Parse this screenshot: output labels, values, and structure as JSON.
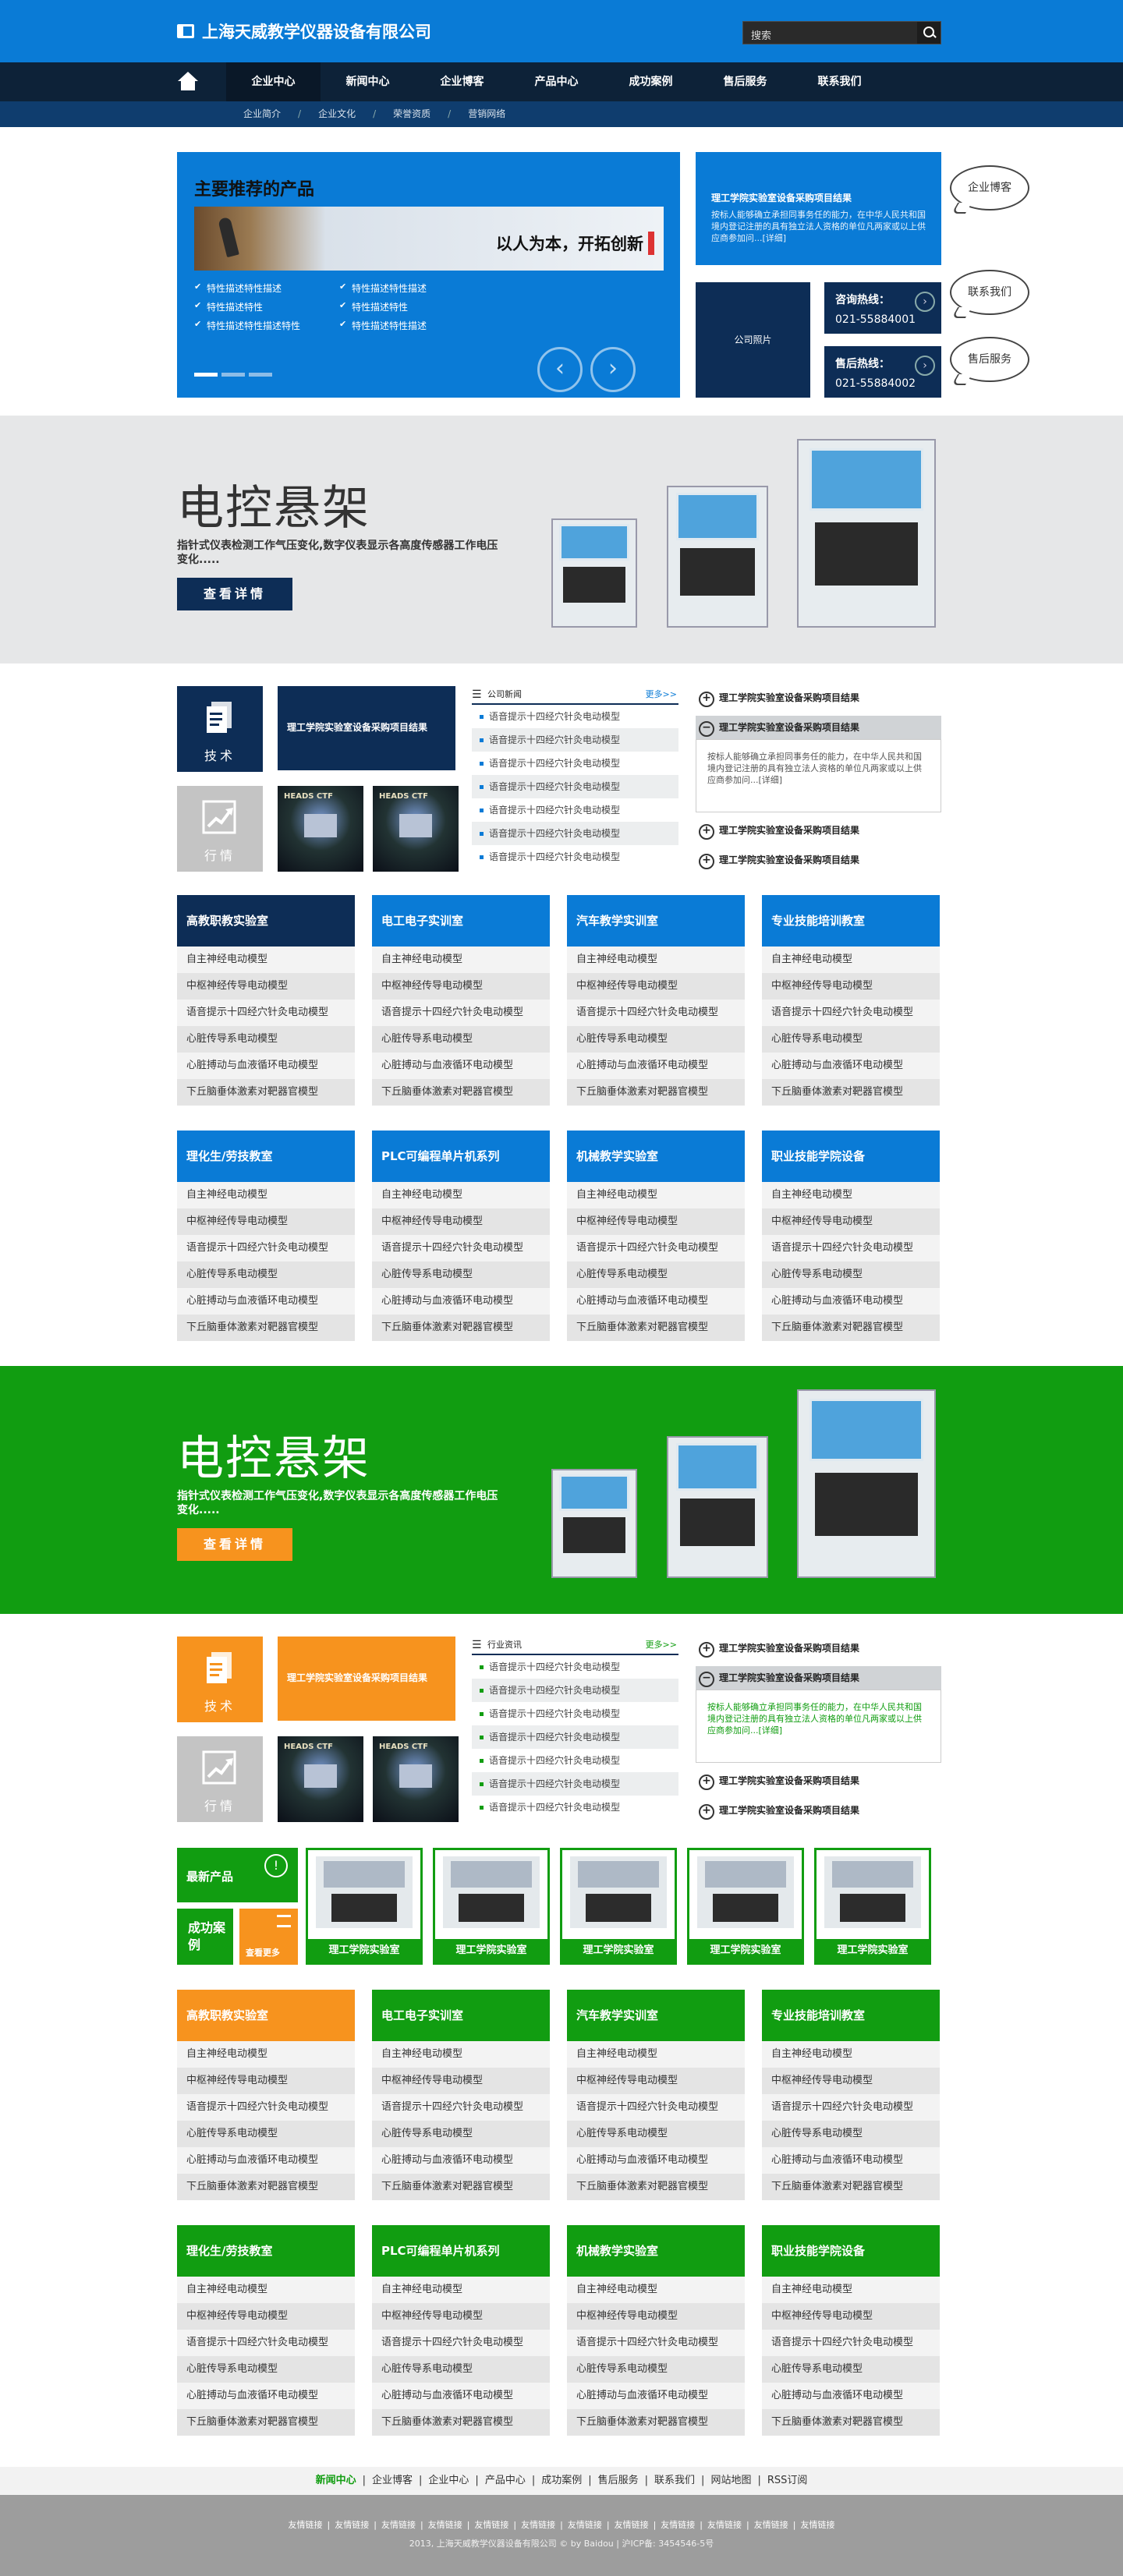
{
  "header": {
    "logo_text": "上海天威教学仪器设备有限公司",
    "search_placeholder": "搜索",
    "nav": [
      "企业中心",
      "新闻中心",
      "企业博客",
      "产品中心",
      "成功案例",
      "售后服务",
      "联系我们"
    ],
    "nav_active": 0,
    "subnav": [
      "企业简介",
      "企业文化",
      "荣誉资质",
      "营销网络"
    ]
  },
  "hero": {
    "title": "主要推荐的产品",
    "slogan": "以人为本，开拓创新",
    "features": [
      "特性描述特性描述",
      "特性描述特性",
      "特性描述特性描述特性",
      "特性描述特性描述",
      "特性描述特性",
      "特性描述特性描述"
    ],
    "news_title": "理工学院实验室设备采购项目结果",
    "news_text": "按标人能够确立承担同事务任的能力，在中华人民共和国境内登记注册的具有独立法人资格的单位凡两家或以上供应商参加问...[详细]",
    "photo_label": "公司照片",
    "hotline1_label": "咨询热线：",
    "hotline1": "021-55884001",
    "hotline2_label": "售后热线：",
    "hotline2": "021-55884002",
    "bubbles": [
      "企业博客",
      "联系我们",
      "售后服务"
    ]
  },
  "banner1": {
    "title": "电控悬架",
    "text": "指针式仪表检测工作气压变化,数字仪表显示各高度传感器工作电压变化.....",
    "button": "查看详情"
  },
  "block1": {
    "tile1": "技术",
    "tile2": "行情",
    "feature": "理工学院实验室设备采购项目结果",
    "thumb_text": "HEADS CTF",
    "list_title": "公司新闻",
    "more": "更多>>",
    "list": [
      "语音提示十四经穴针灸电动模型",
      "语音提示十四经穴针灸电动模型",
      "语音提示十四经穴针灸电动模型",
      "语音提示十四经穴针灸电动模型",
      "语音提示十四经穴针灸电动模型",
      "语音提示十四经穴针灸电动模型",
      "语音提示十四经穴针灸电动模型"
    ],
    "acc": [
      "理工学院实验室设备采购项目结果",
      "理工学院实验室设备采购项目结果",
      "理工学院实验室设备采购项目结果",
      "理工学院实验室设备采购项目结果"
    ],
    "acc_body": "按标人能够确立承担同事务任的能力，在中华人民共和国境内登记注册的具有独立法人资格的单位凡两家或以上供应商参加问...[详细]"
  },
  "grid1": [
    {
      "title": "高教职教实验室",
      "items": [
        "自主神经电动模型",
        "中枢神经传导电动模型",
        "语音提示十四经穴针灸电动模型",
        "心脏传导系电动模型",
        "心脏搏动与血液循环电动模型",
        "下丘脑垂体激素对靶器官模型"
      ]
    },
    {
      "title": "电工电子实训室",
      "items": [
        "自主神经电动模型",
        "中枢神经传导电动模型",
        "语音提示十四经穴针灸电动模型",
        "心脏传导系电动模型",
        "心脏搏动与血液循环电动模型",
        "下丘脑垂体激素对靶器官模型"
      ]
    },
    {
      "title": "汽车教学实训室",
      "items": [
        "自主神经电动模型",
        "中枢神经传导电动模型",
        "语音提示十四经穴针灸电动模型",
        "心脏传导系电动模型",
        "心脏搏动与血液循环电动模型",
        "下丘脑垂体激素对靶器官模型"
      ]
    },
    {
      "title": "专业技能培训教室",
      "items": [
        "自主神经电动模型",
        "中枢神经传导电动模型",
        "语音提示十四经穴针灸电动模型",
        "心脏传导系电动模型",
        "心脏搏动与血液循环电动模型",
        "下丘脑垂体激素对靶器官模型"
      ]
    },
    {
      "title": "理化生/劳技教室",
      "items": [
        "自主神经电动模型",
        "中枢神经传导电动模型",
        "语音提示十四经穴针灸电动模型",
        "心脏传导系电动模型",
        "心脏搏动与血液循环电动模型",
        "下丘脑垂体激素对靶器官模型"
      ]
    },
    {
      "title": "PLC可编程单片机系列",
      "items": [
        "自主神经电动模型",
        "中枢神经传导电动模型",
        "语音提示十四经穴针灸电动模型",
        "心脏传导系电动模型",
        "心脏搏动与血液循环电动模型",
        "下丘脑垂体激素对靶器官模型"
      ]
    },
    {
      "title": "机械教学实验室",
      "items": [
        "自主神经电动模型",
        "中枢神经传导电动模型",
        "语音提示十四经穴针灸电动模型",
        "心脏传导系电动模型",
        "心脏搏动与血液循环电动模型",
        "下丘脑垂体激素对靶器官模型"
      ]
    },
    {
      "title": "职业技能学院设备",
      "items": [
        "自主神经电动模型",
        "中枢神经传导电动模型",
        "语音提示十四经穴针灸电动模型",
        "心脏传导系电动模型",
        "心脏搏动与血液循环电动模型",
        "下丘脑垂体激素对靶器官模型"
      ]
    }
  ],
  "banner2": {
    "title": "电控悬架",
    "text": "指针式仪表检测工作气压变化,数字仪表显示各高度传感器工作电压变化.....",
    "button": "查看详情"
  },
  "block2": {
    "tile1": "技术",
    "tile2": "行情",
    "feature": "理工学院实验室设备采购项目结果",
    "thumb_text": "HEADS CTF",
    "list_title": "行业资讯",
    "more": "更多>>",
    "list": [
      "语音提示十四经穴针灸电动模型",
      "语音提示十四经穴针灸电动模型",
      "语音提示十四经穴针灸电动模型",
      "语音提示十四经穴针灸电动模型",
      "语音提示十四经穴针灸电动模型",
      "语音提示十四经穴针灸电动模型",
      "语音提示十四经穴针灸电动模型"
    ],
    "acc": [
      "理工学院实验室设备采购项目结果",
      "理工学院实验室设备采购项目结果",
      "理工学院实验室设备采购项目结果",
      "理工学院实验室设备采购项目结果"
    ],
    "acc_body": "按标人能够确立承担同事务任的能力，在中华人民共和国境内登记注册的具有独立法人资格的单位凡两家或以上供应商参加问...[详细]"
  },
  "products": {
    "latest": "最新产品",
    "cases": "成功案例",
    "more": "查看更多",
    "items": [
      "理工学院实验室",
      "理工学院实验室",
      "理工学院实验室",
      "理工学院实验室",
      "理工学院实验室"
    ]
  },
  "grid2": [
    {
      "title": "高教职教实验室",
      "items": [
        "自主神经电动模型",
        "中枢神经传导电动模型",
        "语音提示十四经穴针灸电动模型",
        "心脏传导系电动模型",
        "心脏搏动与血液循环电动模型",
        "下丘脑垂体激素对靶器官模型"
      ]
    },
    {
      "title": "电工电子实训室",
      "items": [
        "自主神经电动模型",
        "中枢神经传导电动模型",
        "语音提示十四经穴针灸电动模型",
        "心脏传导系电动模型",
        "心脏搏动与血液循环电动模型",
        "下丘脑垂体激素对靶器官模型"
      ]
    },
    {
      "title": "汽车教学实训室",
      "items": [
        "自主神经电动模型",
        "中枢神经传导电动模型",
        "语音提示十四经穴针灸电动模型",
        "心脏传导系电动模型",
        "心脏搏动与血液循环电动模型",
        "下丘脑垂体激素对靶器官模型"
      ]
    },
    {
      "title": "专业技能培训教室",
      "items": [
        "自主神经电动模型",
        "中枢神经传导电动模型",
        "语音提示十四经穴针灸电动模型",
        "心脏传导系电动模型",
        "心脏搏动与血液循环电动模型",
        "下丘脑垂体激素对靶器官模型"
      ]
    },
    {
      "title": "理化生/劳技教室",
      "items": [
        "自主神经电动模型",
        "中枢神经传导电动模型",
        "语音提示十四经穴针灸电动模型",
        "心脏传导系电动模型",
        "心脏搏动与血液循环电动模型",
        "下丘脑垂体激素对靶器官模型"
      ]
    },
    {
      "title": "PLC可编程单片机系列",
      "items": [
        "自主神经电动模型",
        "中枢神经传导电动模型",
        "语音提示十四经穴针灸电动模型",
        "心脏传导系电动模型",
        "心脏搏动与血液循环电动模型",
        "下丘脑垂体激素对靶器官模型"
      ]
    },
    {
      "title": "机械教学实验室",
      "items": [
        "自主神经电动模型",
        "中枢神经传导电动模型",
        "语音提示十四经穴针灸电动模型",
        "心脏传导系电动模型",
        "心脏搏动与血液循环电动模型",
        "下丘脑垂体激素对靶器官模型"
      ]
    },
    {
      "title": "职业技能学院设备",
      "items": [
        "自主神经电动模型",
        "中枢神经传导电动模型",
        "语音提示十四经穴针灸电动模型",
        "心脏传导系电动模型",
        "心脏搏动与血液循环电动模型",
        "下丘脑垂体激素对靶器官模型"
      ]
    }
  ],
  "footer": {
    "nav": [
      "新闻中心",
      "企业博客",
      "企业中心",
      "产品中心",
      "成功案例",
      "售后服务",
      "联系我们",
      "网站地图",
      "RSS订阅"
    ],
    "links": [
      "友情链接",
      "友情链接",
      "友情链接",
      "友情链接",
      "友情链接",
      "友情链接",
      "友情链接",
      "友情链接",
      "友情链接",
      "友情链接",
      "友情链接",
      "友情链接"
    ],
    "copyright": "2013, 上海天威教学仪器设备有限公司 © by Baidou | 沪ICP备: 3454546-5号"
  },
  "colors": {
    "blue": "#0a7bd6",
    "navy": "#0d2d56",
    "green": "#119d11",
    "orange": "#f7931e",
    "gray": "#e6e7e8"
  }
}
